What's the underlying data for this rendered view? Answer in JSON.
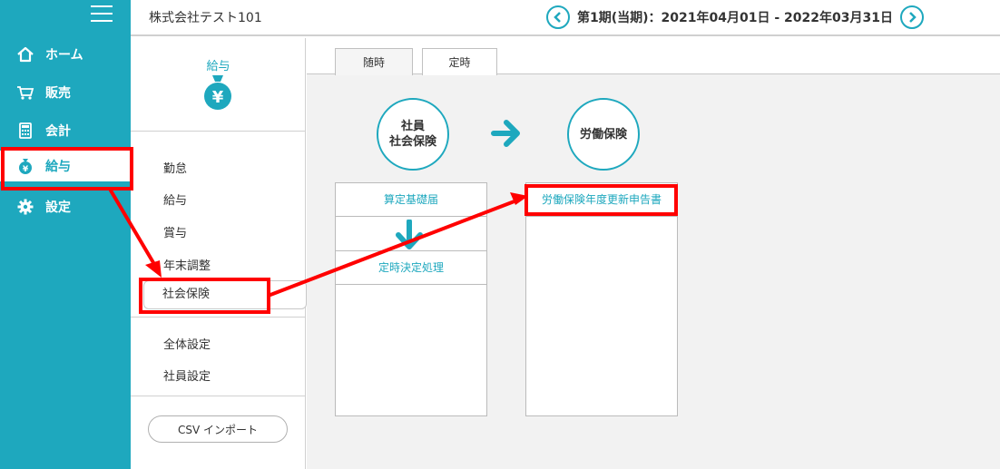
{
  "company_name": "株式会社テスト101",
  "period_label": "第1期(当期)：2021年04月01日 - 2022年03月31日",
  "nav": {
    "items": [
      {
        "label": "ホーム",
        "icon": "home-icon"
      },
      {
        "label": "販売",
        "icon": "cart-icon"
      },
      {
        "label": "会計",
        "icon": "calculator-icon"
      },
      {
        "label": "給与",
        "icon": "money-bag-icon"
      },
      {
        "label": "設定",
        "icon": "gear-icon"
      }
    ]
  },
  "submenu": {
    "title": "給与",
    "items_top": [
      "勤怠",
      "給与",
      "賞与",
      "年末調整",
      "社会保険"
    ],
    "items_bottom": [
      "全体設定",
      "社員設定"
    ],
    "csv_button": "CSV インポート"
  },
  "tabs": [
    "随時",
    "定時"
  ],
  "flow": {
    "circle_left": "社員\n社会保険",
    "circle_right": "労働保険",
    "left_box": {
      "row1": "算定基礎届",
      "row2": "定時決定処理"
    },
    "right_box": {
      "row1": "労働保険年度更新申告書"
    }
  },
  "colors": {
    "accent": "#1ea8be",
    "annotation": "#ff0000"
  }
}
